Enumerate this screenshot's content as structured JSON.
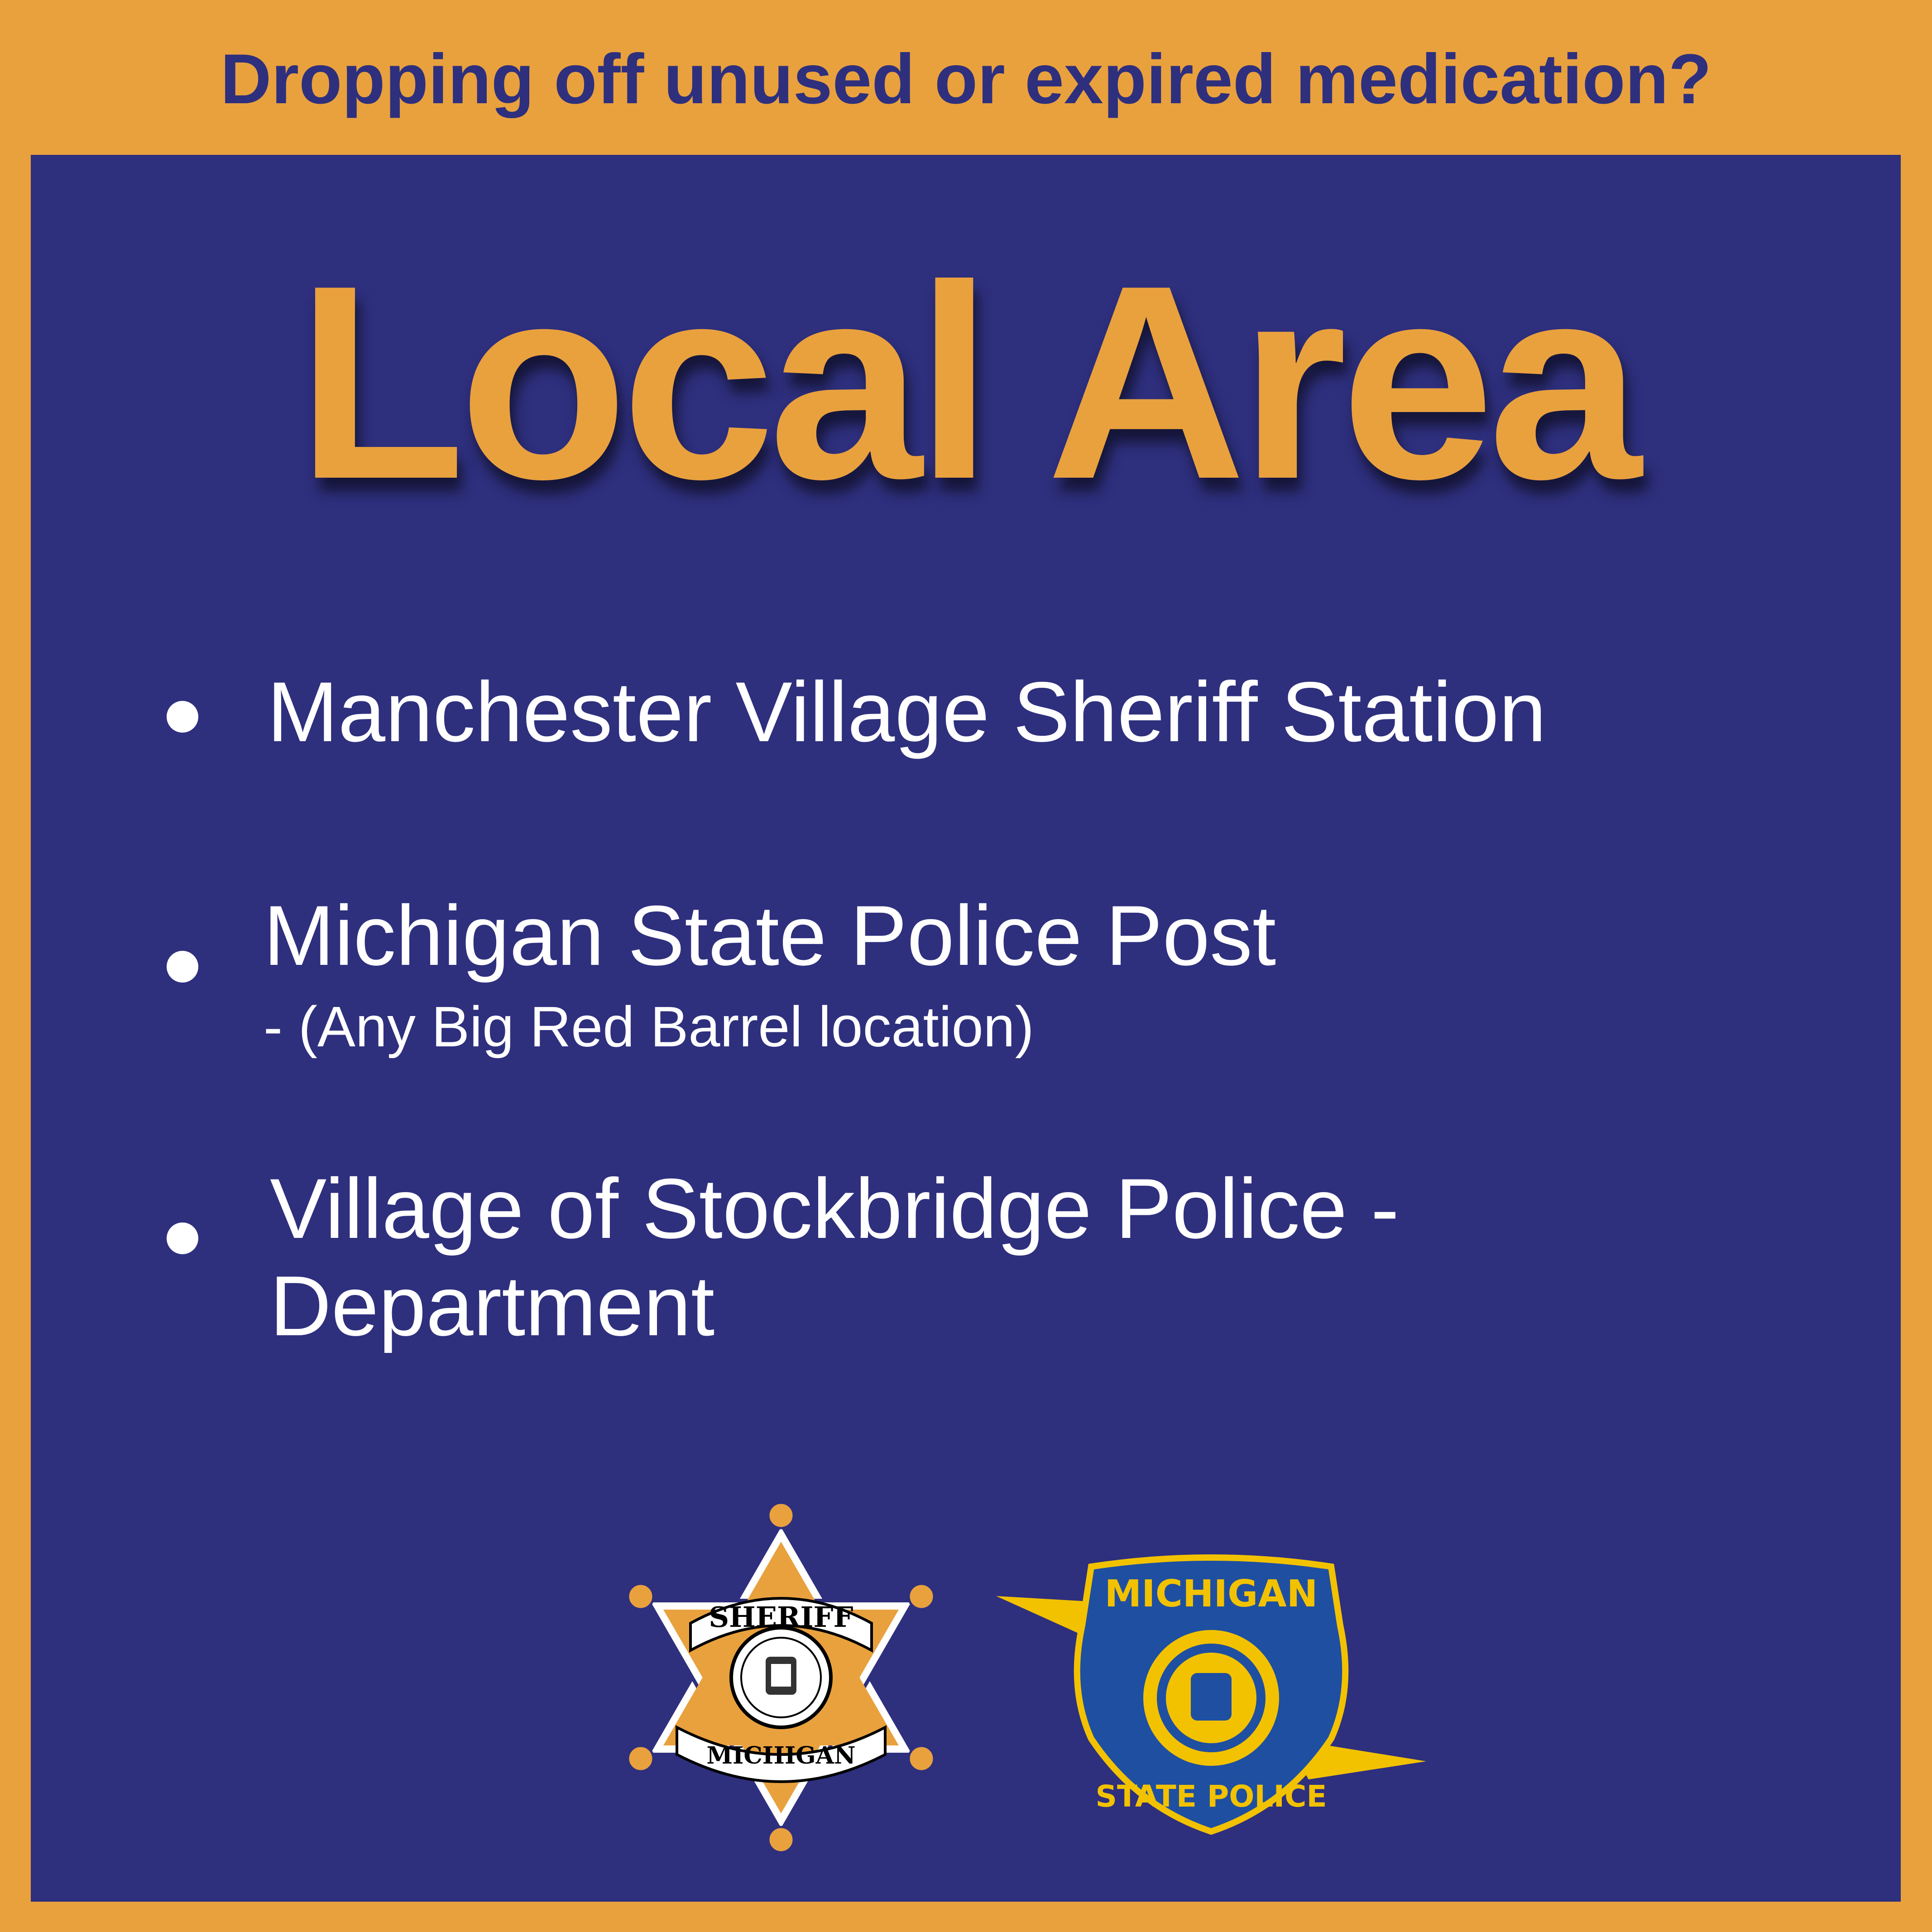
{
  "header": {
    "question": "Dropping off unused or expired medication?"
  },
  "title": "Local Area",
  "locations": [
    {
      "name": "Manchester Village Sheriff Station"
    },
    {
      "name": "Michigan State Police Post",
      "note": "- (Any Big Red Barrel location)"
    },
    {
      "name_line1": "Village of Stockbridge Police -",
      "name_line2": "Department"
    }
  ],
  "logos": {
    "sheriff": {
      "icon": "sheriff-star-badge-icon",
      "top_text": "SHERIFF",
      "bottom_text": "MICHIGAN"
    },
    "state_police": {
      "icon": "michigan-state-police-shield-icon",
      "top_text": "MICHIGAN",
      "bottom_text": "STATE POLICE"
    }
  },
  "colors": {
    "orange": "#E9A13E",
    "navy": "#2E2F7D",
    "white": "#FFFFFF",
    "gold": "#F2C200",
    "blue": "#1F4FA0"
  }
}
